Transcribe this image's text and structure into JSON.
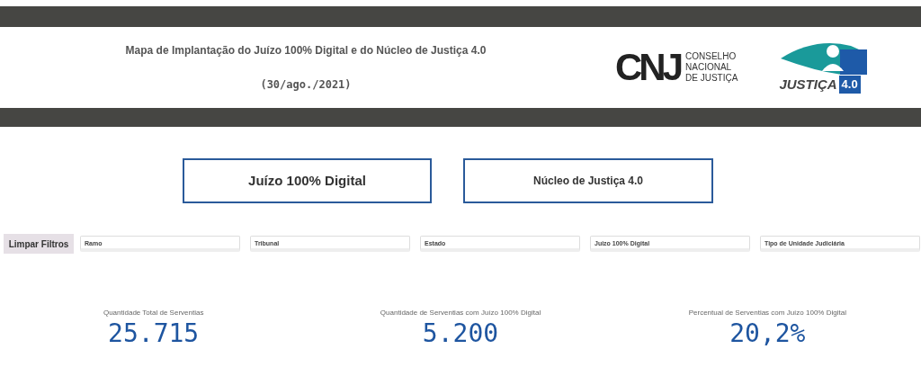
{
  "header": {
    "title": "Mapa de Implantação do Juízo 100% Digital e do Núcleo de Justiça 4.0",
    "date": "(30/ago./2021)",
    "cnj_logo": {
      "letters": "CNJ",
      "lines": [
        "CONSELHO",
        "NACIONAL",
        "DE JUSTIÇA"
      ]
    },
    "justica_logo": {
      "word": "JUSTIÇA",
      "badge": "4.0"
    }
  },
  "nav_buttons": [
    "Juízo 100% Digital",
    "Núcleo de Justiça 4.0"
  ],
  "clear_button": "Limpar Filtros",
  "filters": [
    "Ramo",
    "Tribunal",
    "Estado",
    "Juizo 100% Digital",
    "Tipo de Unidade Judiciária"
  ],
  "kpis": [
    {
      "label": "Quantidade Total de Serventias",
      "value": "25.715"
    },
    {
      "label": "Quantidade de Serventias com Juízo 100% Digital",
      "value": "5.200"
    },
    {
      "label": "Percentual de Serventias com Juízo 100% Digital",
      "value": "20,2%"
    }
  ]
}
